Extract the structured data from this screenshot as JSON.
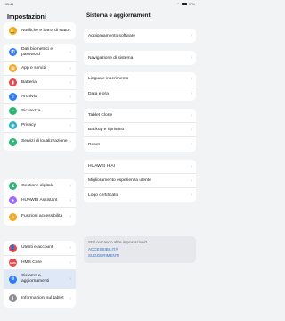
{
  "status": {
    "time": "19:46",
    "battery": "97%"
  },
  "left": {
    "title": "Impostazioni",
    "groups": [
      [
        {
          "label": "Notifiche e barra di stato",
          "icon": "bell-icon",
          "color": "#f5a623"
        }
      ],
      [
        {
          "label": "Dati biometrici e password",
          "icon": "key-icon",
          "color": "#2e7cf6"
        },
        {
          "label": "App e servizi",
          "icon": "apps-icon",
          "color": "#f5a623"
        },
        {
          "label": "Batteria",
          "icon": "battery-icon",
          "color": "#e5484d"
        },
        {
          "label": "Archivio",
          "icon": "storage-icon",
          "color": "#2e7cf6"
        },
        {
          "label": "Sicurezza",
          "icon": "shield-icon",
          "color": "#2ab673"
        },
        {
          "label": "Privacy",
          "icon": "privacy-icon",
          "color": "#2bb1c8"
        },
        {
          "label": "Servizi di localizzazione",
          "icon": "location-icon",
          "color": "#2ab673"
        }
      ],
      [
        {
          "label": "Gestione digitale",
          "icon": "hourglass-icon",
          "color": "#2ab673"
        },
        {
          "label": "HUAWEI Assistant",
          "icon": "assistant-icon",
          "color": "#9b6bff"
        },
        {
          "label": "Funzioni accessibilità",
          "icon": "accessibility-icon",
          "color": "#f5a623"
        }
      ],
      [
        {
          "label": "Utenti e account",
          "icon": "user-icon",
          "color": "#e5484d"
        },
        {
          "label": "HMS Core",
          "icon": "hms-icon",
          "color": "#e5484d"
        },
        {
          "label": "Sistema e aggiornamenti",
          "icon": "system-icon",
          "color": "#2e7cf6",
          "active": true
        },
        {
          "label": "Informazioni sul tablet",
          "icon": "info-icon",
          "color": "#8e8e93"
        }
      ]
    ]
  },
  "right": {
    "title": "Sistema e aggiornamenti",
    "groups": [
      [
        "Aggiornamento software"
      ],
      [
        "Navigazione di sistema"
      ],
      [
        "Lingua e inserimento",
        "Data e ora"
      ],
      [
        "Tablet Clone",
        "Backup e ripristino",
        "Reset"
      ],
      [
        "HUAWEI HiAI",
        "Miglioramento esperienza utente",
        "Logo certificato"
      ]
    ],
    "suggestions": {
      "question": "Stai cercando altre impostazioni?",
      "link1": "ACCESSIBILITÀ",
      "link2": "SUGGERIMENTI"
    }
  }
}
